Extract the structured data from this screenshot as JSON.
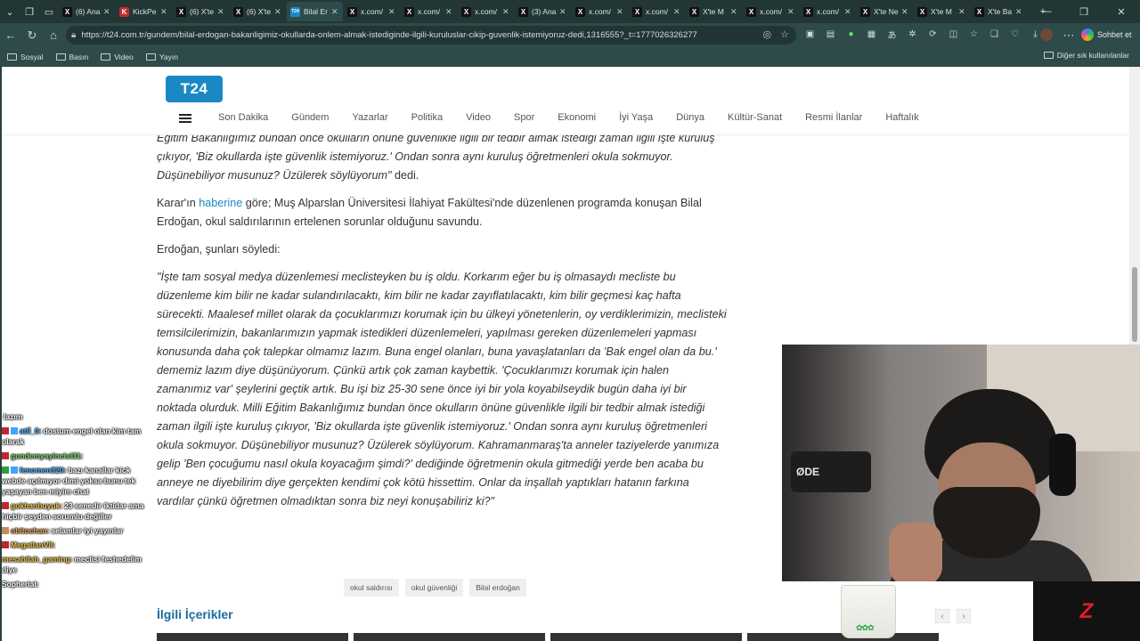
{
  "browser": {
    "tabs": [
      {
        "title": "(6) Ana",
        "fav": "X",
        "color": "#111111"
      },
      {
        "title": "KickPe",
        "fav": "K",
        "color": "#c02b2b"
      },
      {
        "title": "(6) X'te",
        "fav": "X",
        "color": "#111111"
      },
      {
        "title": "(6) X'te",
        "fav": "X",
        "color": "#111111"
      },
      {
        "title": "Bilal Er",
        "fav": "T24",
        "color": "#1b88c4",
        "active": true
      },
      {
        "title": "x.com/",
        "fav": "X",
        "color": "#111111"
      },
      {
        "title": "x.com/",
        "fav": "X",
        "color": "#111111"
      },
      {
        "title": "x.com/",
        "fav": "X",
        "color": "#111111"
      },
      {
        "title": "(3) Ana",
        "fav": "X",
        "color": "#111111"
      },
      {
        "title": "x.com/",
        "fav": "X",
        "color": "#111111"
      },
      {
        "title": "x.com/",
        "fav": "X",
        "color": "#111111"
      },
      {
        "title": "X'te M",
        "fav": "X",
        "color": "#111111"
      },
      {
        "title": "x.com/",
        "fav": "X",
        "color": "#111111"
      },
      {
        "title": "x.com/",
        "fav": "X",
        "color": "#111111"
      },
      {
        "title": "X'te Ne",
        "fav": "X",
        "color": "#111111"
      },
      {
        "title": "X'te M",
        "fav": "X",
        "color": "#111111"
      },
      {
        "title": "X'te Ba",
        "fav": "X",
        "color": "#111111"
      }
    ],
    "url": "https://t24.com.tr/gundem/bilal-erdogan-bakanligimiz-okullarda-onlem-almak-istediginde-ilgili-kuruluslar-cikip-guvenlik-istemiyoruz-dedi,1316555?_t=1777026326277",
    "copilot_label": "Sohbet et",
    "bookmarks": [
      "Sosyal",
      "Basın",
      "Video",
      "Yayın"
    ],
    "bookmarks_right": "Diğer sık kullanılanlar"
  },
  "site": {
    "logo": "T24",
    "nav": [
      "Son Dakika",
      "Gündem",
      "Yazarlar",
      "Politika",
      "Video",
      "Spor",
      "Ekonomi",
      "İyi Yaşa",
      "Dünya",
      "Kültür-Sanat",
      "Resmi İlanlar",
      "Haftalık"
    ]
  },
  "article": {
    "p1_quote": "Eğitim Bakanlığımız bundan önce okulların önüne güvenlikle ilgili bir tedbir almak istediği zaman ilgili işte kuruluş çıkıyor, 'Biz okullarda işte güvenlik istemiyoruz.' Ondan sonra aynı kuruluş öğretmenleri okula sokmuyor. Düşünebiliyor musunuz? Üzülerek söylüyorum\"",
    "p1_tail": " dedi.",
    "p2_pre": "Karar'ın ",
    "p2_link": "haberine",
    "p2_post": " göre; Muş Alparslan Üniversitesi İlahiyat Fakültesi'nde düzenlenen programda konuşan Bilal Erdoğan, okul saldırılarının ertelenen sorunlar olduğunu savundu.",
    "p3": "Erdoğan, şunları söyledi:",
    "p4": "\"İşte tam sosyal medya düzenlemesi meclisteyken bu iş oldu. Korkarım eğer bu iş olmasaydı mecliste bu düzenleme kim bilir ne kadar sulandırılacaktı, kim bilir ne kadar zayıflatılacaktı, kim bilir geçmesi kaç hafta sürecekti. Maalesef millet olarak da çocuklarımızı korumak için bu ülkeyi yönetenlerin, oy verdiklerimizin, meclisteki temsilcilerimizin, bakanlarımızın yapmak istedikleri düzenlemeleri, yapılması gereken düzenlemeleri yapması konusunda daha çok talepkar olmamız lazım. Buna engel olanları, buna yavaşlatanları da 'Bak engel olan da bu.' dememiz lazım diye düşünüyorum. Çünkü artık çok zaman kaybettik. 'Çocuklarımızı korumak için halen zamanımız var' şeylerini geçtik artık. Bu işi biz 25-30 sene önce iyi bir yola koyabilseydik bugün daha iyi bir noktada olurduk. Milli Eğitim Bakanlığımız bundan önce okulların önüne güvenlikle ilgili bir tedbir almak istediği zaman ilgili işte kuruluş çıkıyor, 'Biz okullarda işte güvenlik istemiyoruz.' Ondan sonra aynı kuruluş öğretmenleri okula sokmuyor. Düşünebiliyor musunuz? Üzülerek söylüyorum. Kahramanmaraş'ta anneler taziyelerde yanımıza gelip 'Ben çocuğumu nasıl okula koyacağım şimdi?' dediğinde öğretmenin okula gitmediği yerde ben acaba bu anneye ne diyebilirim diye gerçekten kendimi çok kötü hissettim. Onlar da inşallah yaptıkları hatanın farkına vardılar çünkü öğretmen olmadıktan sonra biz neyi konuşabiliriz ki?\"",
    "tags": [
      "okul saldırısı",
      "okul güvenliği",
      "Bilal erdoğan"
    ],
    "related_title": "İlgili İçerikler"
  },
  "chat": {
    "messages": [
      {
        "user": "",
        "text": "lazım",
        "ucolor": "#ffffff",
        "badges": []
      },
      {
        "user": "atiİ_0:",
        "text": "dostum engel olan kim tam olarak",
        "ucolor": "#4fb2ff",
        "badges": [
          "#c0262d",
          "#3ea6ff"
        ]
      },
      {
        "user": "gundemyayincisi31:",
        "text": "",
        "ucolor": "#7bd86a",
        "badges": [
          "#c0262d"
        ]
      },
      {
        "user": "fenomen320:",
        "text": "bazı kanallar kick webde açılmıyor dimi yoksa bunu tek yaşayan ben miyim chat",
        "ucolor": "#4fb2ff",
        "badges": [
          "#2e9e44",
          "#3ea6ff"
        ]
      },
      {
        "user": "gokhanbuyuk:",
        "text": "23 senedir iktidar ama hiçbir şeyden sorumlu değiller",
        "ucolor": "#f2c94c",
        "badges": [
          "#c0262d"
        ]
      },
      {
        "user": "obitochan:",
        "text": "selamlar iyi yayınlar",
        "ucolor": "#f2a65a",
        "badges": [
          "#c98a5b"
        ]
      },
      {
        "user": "MegatlanVII:",
        "text": "",
        "ucolor": "#f2c94c",
        "badges": [
          "#c0262d"
        ]
      },
      {
        "user": "mesahilah_gaming:",
        "text": "meclisi feshedelim diye",
        "ucolor": "#f2c94c",
        "badges": []
      },
      {
        "user": "Sopherial:",
        "text": "",
        "ucolor": "#ffffff",
        "badges": []
      }
    ]
  },
  "overlay": {
    "mic_label": "ØDE",
    "brand": "Z"
  }
}
